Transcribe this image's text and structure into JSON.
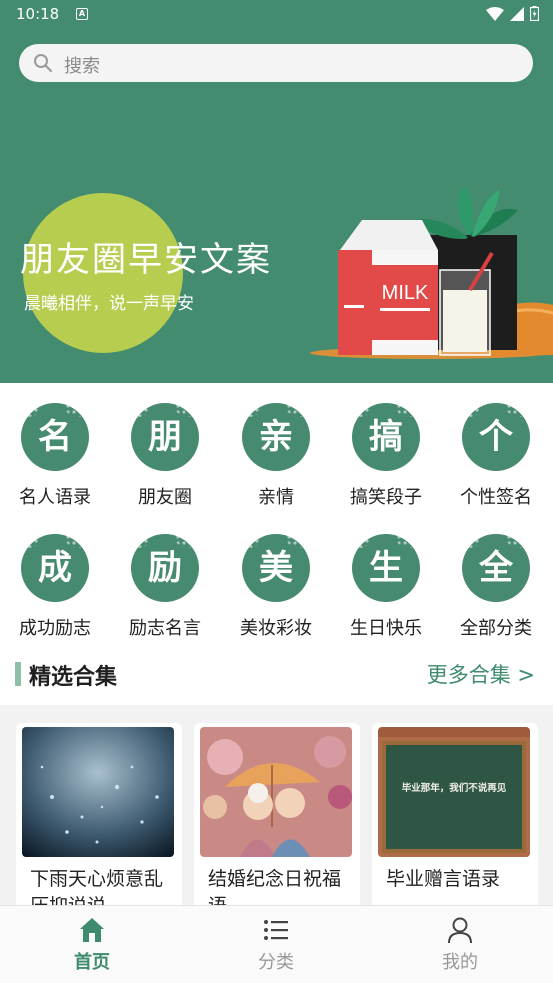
{
  "status_bar": {
    "time": "10:18",
    "badge": "A"
  },
  "search": {
    "placeholder": "搜索"
  },
  "banner": {
    "title": "朋友圈早安文案",
    "subtitle": "晨曦相伴，说一声早安",
    "milk_text": "MILK"
  },
  "categories": [
    {
      "char": "名",
      "label": "名人语录"
    },
    {
      "char": "朋",
      "label": "朋友圈"
    },
    {
      "char": "亲",
      "label": "亲情"
    },
    {
      "char": "搞",
      "label": "搞笑段子"
    },
    {
      "char": "个",
      "label": "个性签名"
    },
    {
      "char": "成",
      "label": "成功励志"
    },
    {
      "char": "励",
      "label": "励志名言"
    },
    {
      "char": "美",
      "label": "美妆彩妆"
    },
    {
      "char": "生",
      "label": "生日快乐"
    },
    {
      "char": "全",
      "label": "全部分类"
    }
  ],
  "featured": {
    "title": "精选合集",
    "more": "更多合集 >",
    "cards": [
      {
        "title": "下雨天心烦意乱压抑说说"
      },
      {
        "title": "结婚纪念日祝福语"
      },
      {
        "title": "毕业赠言语录",
        "board_text": "毕业那年，我们不说再见"
      }
    ]
  },
  "tabbar": {
    "items": [
      {
        "label": "首页",
        "icon": "home-icon",
        "active": true
      },
      {
        "label": "分类",
        "icon": "list-icon",
        "active": false
      },
      {
        "label": "我的",
        "icon": "user-icon",
        "active": false
      }
    ]
  },
  "colors": {
    "primary": "#438c6f",
    "accent_circle": "#b7cd50",
    "active_tab": "#3e8b6d"
  }
}
